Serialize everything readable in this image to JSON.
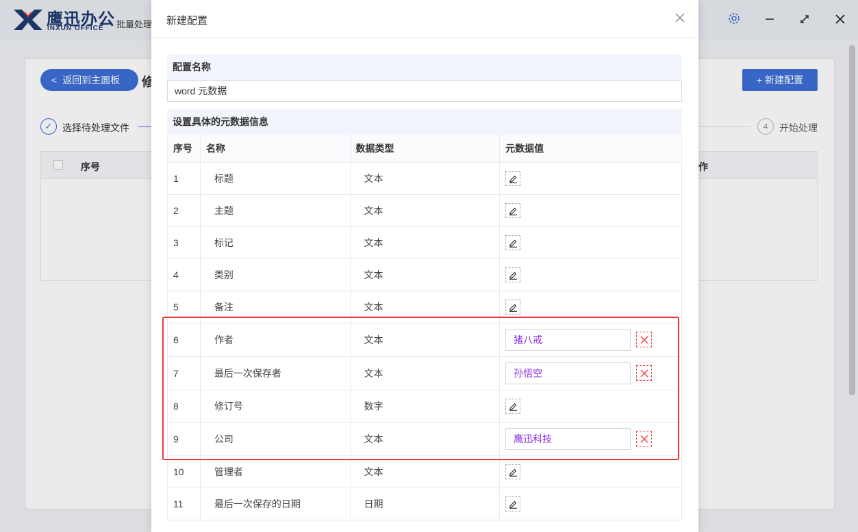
{
  "app": {
    "brand_cn": "鹰迅办公",
    "brand_en": "INXUN OFFICE",
    "title": "批量处理"
  },
  "background": {
    "back_label": "返回到主面板",
    "heading": "修",
    "new_config_label": "新建配置",
    "step1_label": "选择待处理文件",
    "step4_num": "4",
    "step4_label": "开始处理",
    "table_col_index": "序号",
    "table_col_action": "作"
  },
  "modal": {
    "title": "新建配置",
    "close_glyph": "×",
    "config_name_label": "配置名称",
    "config_name_value": "word 元数据",
    "meta_section_label": "设置具体的元数据信息",
    "columns": {
      "index": "序号",
      "name": "名称",
      "type": "数据类型",
      "value": "元数据值"
    },
    "rows": [
      {
        "index": "1",
        "name": "标题",
        "type": "文本"
      },
      {
        "index": "2",
        "name": "主题",
        "type": "文本"
      },
      {
        "index": "3",
        "name": "标记",
        "type": "文本"
      },
      {
        "index": "4",
        "name": "类别",
        "type": "文本"
      },
      {
        "index": "5",
        "name": "备注",
        "type": "文本"
      },
      {
        "index": "6",
        "name": "作者",
        "type": "文本",
        "value": "猪八戒"
      },
      {
        "index": "7",
        "name": "最后一次保存者",
        "type": "文本",
        "value": "孙悟空"
      },
      {
        "index": "8",
        "name": "修订号",
        "type": "数字"
      },
      {
        "index": "9",
        "name": "公司",
        "type": "文本",
        "value": "鹰迅科技"
      },
      {
        "index": "10",
        "name": "管理者",
        "type": "文本"
      },
      {
        "index": "11",
        "name": "最后一次保存的日期",
        "type": "日期"
      }
    ]
  },
  "colors": {
    "accent": "#3c6fd8",
    "value_text": "#8a2be2",
    "delete": "#e44444",
    "highlight": "#e53935"
  }
}
